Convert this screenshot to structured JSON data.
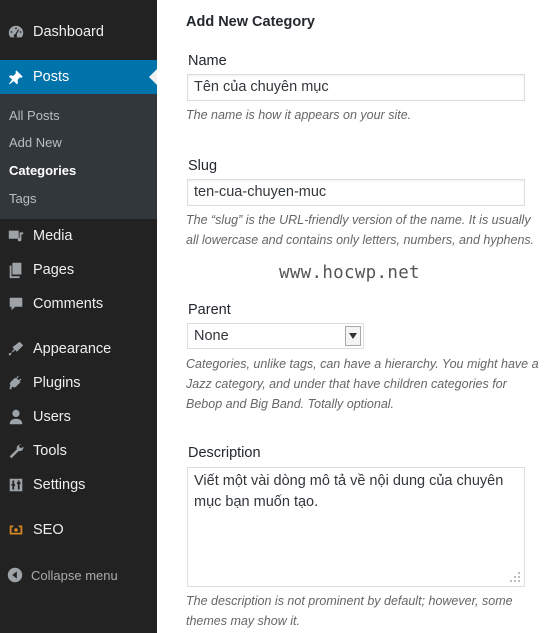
{
  "sidebar": {
    "dashboard": "Dashboard",
    "posts": "Posts",
    "submenu": [
      "All Posts",
      "Add New",
      "Categories",
      "Tags"
    ],
    "media": "Media",
    "pages": "Pages",
    "comments": "Comments",
    "appearance": "Appearance",
    "plugins": "Plugins",
    "users": "Users",
    "tools": "Tools",
    "settings": "Settings",
    "seo": "SEO",
    "collapse": "Collapse menu",
    "accent_color": "#0073aa"
  },
  "form": {
    "heading": "Add New Category",
    "name_label": "Name",
    "name_value": "Tên của chuyên mục",
    "name_help": "The name is how it appears on your site.",
    "slug_label": "Slug",
    "slug_value": "ten-cua-chuyen-muc",
    "slug_help": "The “slug” is the URL-friendly version of the name. It is usually all lowercase and contains only letters, numbers, and hyphens.",
    "parent_label": "Parent",
    "parent_value": "None",
    "parent_help": "Categories, unlike tags, can have a hierarchy. You might have a Jazz category, and under that have children categories for Bebop and Big Band. Totally optional.",
    "description_label": "Description",
    "description_value": "Viết một vài dòng mô tả về nội dung của chuyên mục bạn muốn tạo.",
    "description_help": "The description is not prominent by default; however, some themes may show it."
  },
  "watermark": "www.hocwp.net"
}
